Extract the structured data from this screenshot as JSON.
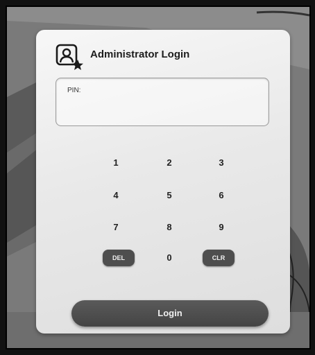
{
  "dialog": {
    "title": "Administrator Login",
    "icon": "admin-user-icon"
  },
  "pin": {
    "label": "PIN:",
    "value": ""
  },
  "keypad": {
    "keys": [
      "1",
      "2",
      "3",
      "4",
      "5",
      "6",
      "7",
      "8",
      "9",
      "DEL",
      "0",
      "CLR"
    ]
  },
  "login_button": {
    "label": "Login"
  },
  "colors": {
    "dialog_background": "#eeeeee",
    "button_dark": "#4e4e4e",
    "text": "#222222"
  }
}
